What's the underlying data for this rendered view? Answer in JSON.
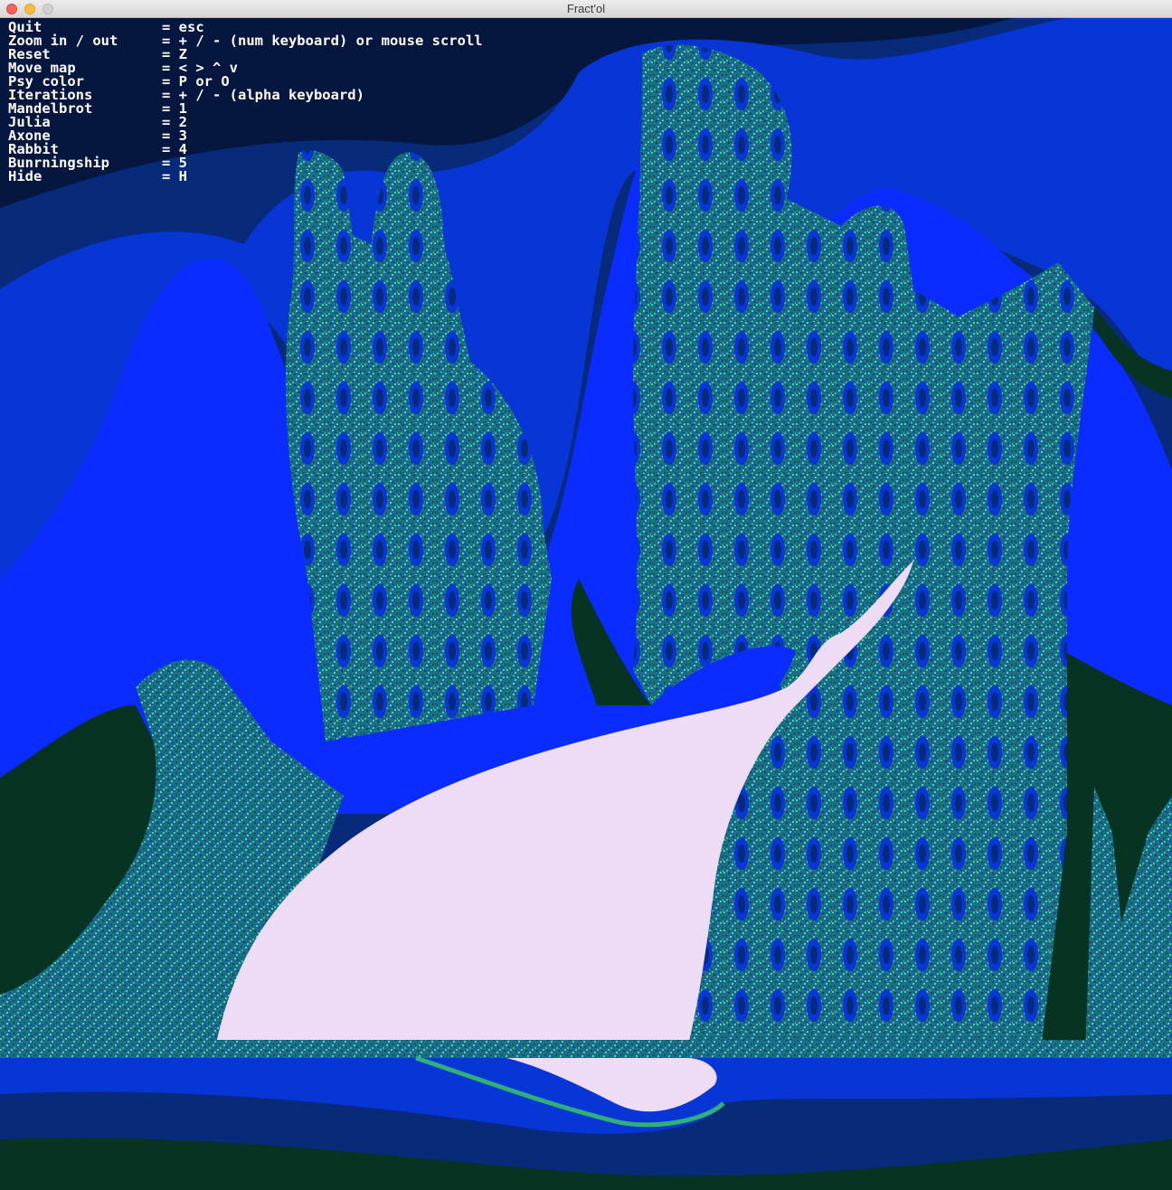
{
  "window": {
    "title": "Fract'ol"
  },
  "help_menu": [
    {
      "label": "Quit",
      "value": "= esc"
    },
    {
      "label": "Zoom in / out",
      "value": "= + / - (num keyboard) or mouse scroll"
    },
    {
      "label": "Reset",
      "value": "= Z"
    },
    {
      "label": "Move map",
      "value": "= < > ^ v"
    },
    {
      "label": "Psy color",
      "value": "= P or O"
    },
    {
      "label": "Iterations",
      "value": "= + / - (alpha keyboard)"
    },
    {
      "label": "Mandelbrot",
      "value": "= 1"
    },
    {
      "label": "Julia",
      "value": "= 2"
    },
    {
      "label": "Axone",
      "value": "= 3"
    },
    {
      "label": "Rabbit",
      "value": "= 4"
    },
    {
      "label": "Bunrningship",
      "value": "= 5"
    },
    {
      "label": "Hide",
      "value": "= H"
    }
  ],
  "colors": {
    "deep_navy": "#05163f",
    "navy": "#072b7a",
    "blue": "#0735d6",
    "bright_blue": "#0a2cff",
    "dark_green": "#063322",
    "teal": "#2a9a92",
    "pale_pink": "#eedcf4"
  }
}
